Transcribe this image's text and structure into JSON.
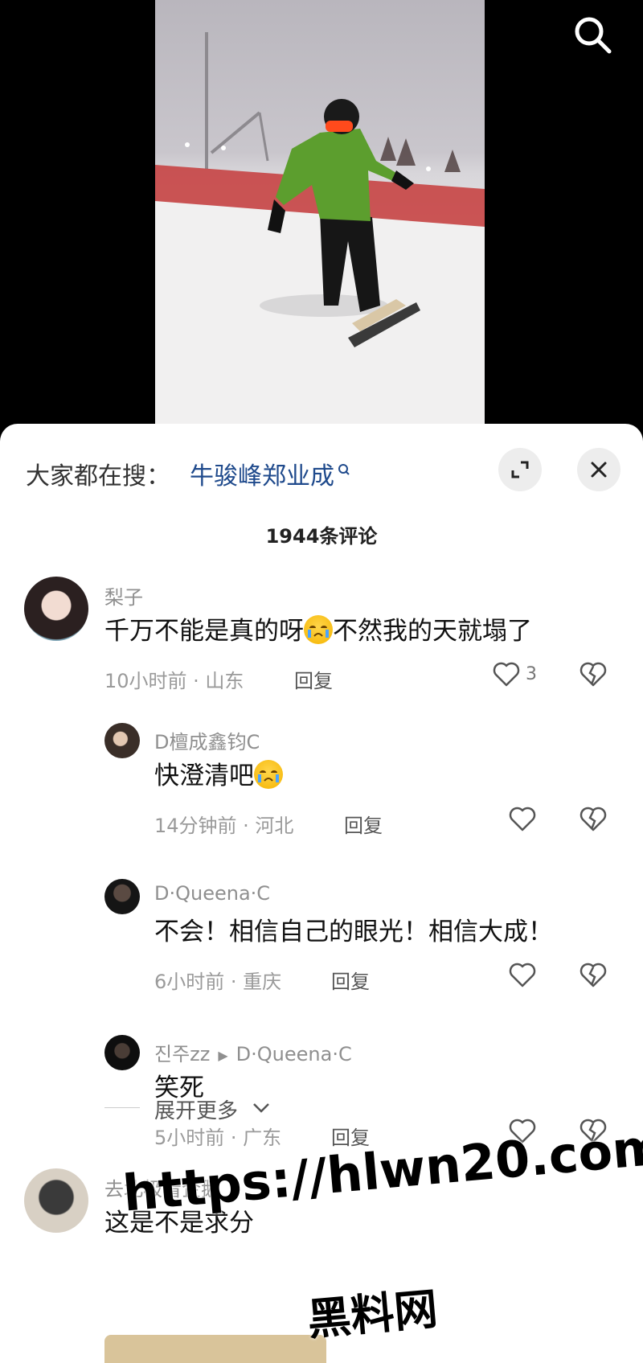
{
  "video": {
    "search_icon": "search-icon"
  },
  "header": {
    "trending_prefix": "大家都在搜：",
    "trending_term": "牛骏峰郑业成",
    "expand_icon": "expand-icon",
    "close_icon": "close-icon"
  },
  "comment_count": "1944条评论",
  "comments": [
    {
      "author": "梨子",
      "text_before": "千万不能是真的呀",
      "text_after": "不然我的天就塌了",
      "time": "10小时前 · 山东",
      "reply_label": "回复",
      "likes": "3"
    },
    {
      "author": "D檀成鑫钧C",
      "text_before": "快澄清吧",
      "text_after": "",
      "time": "14分钟前 · 河北",
      "reply_label": "回复"
    },
    {
      "author": "D·Queena·C",
      "text_before": "不会！相信自己的眼光！相信大成！",
      "text_after": "",
      "time": "6小时前 · 重庆",
      "reply_label": "回复"
    },
    {
      "author": "진주zz",
      "reply_to": "D·Queena·C",
      "text_before": "笑死",
      "text_after": "",
      "time": "5小时前 · 广东",
      "reply_label": "回复"
    },
    {
      "author": "去北极看企鹅",
      "text_before": "这是不是求分",
      "text_after": ""
    }
  ],
  "expand_more": "展开更多",
  "watermark": {
    "url": "https://hlwn20.com",
    "site": "黑料网"
  }
}
